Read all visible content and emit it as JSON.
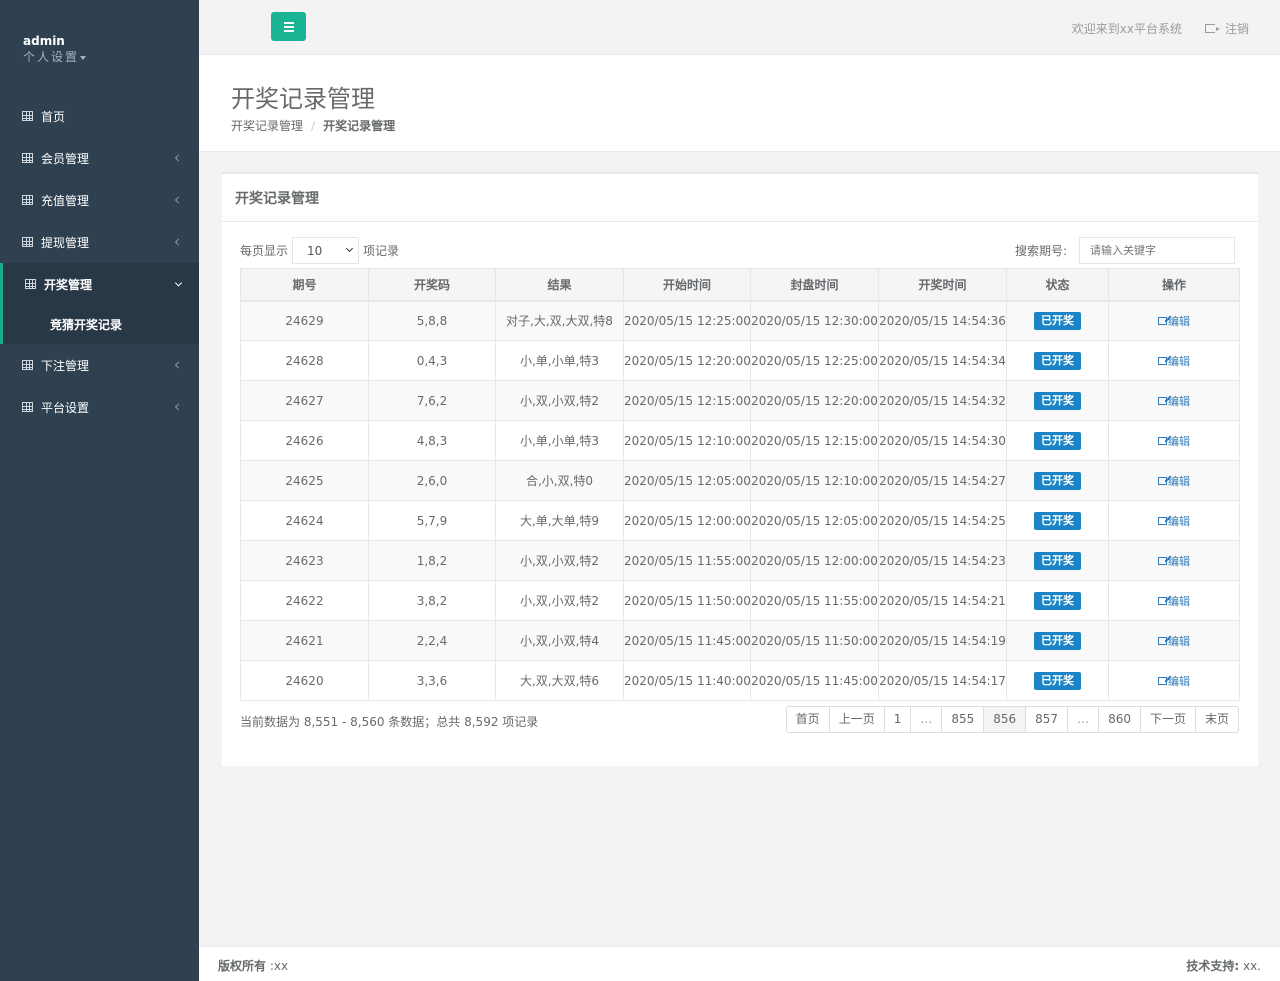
{
  "sidebar": {
    "user": "admin",
    "settings": "个人设置",
    "items": [
      {
        "label": "首页",
        "has_arrow": false
      },
      {
        "label": "会员管理",
        "has_arrow": true
      },
      {
        "label": "充值管理",
        "has_arrow": true
      },
      {
        "label": "提现管理",
        "has_arrow": true
      },
      {
        "label": "开奖管理",
        "has_arrow": true,
        "active": true
      },
      {
        "label": "竞猜开奖记录",
        "sub": true
      },
      {
        "label": "下注管理",
        "has_arrow": true
      },
      {
        "label": "平台设置",
        "has_arrow": true
      }
    ]
  },
  "topbar": {
    "welcome": "欢迎来到xx平台系统",
    "logout": "注销"
  },
  "heading": {
    "title": "开奖记录管理",
    "breadcrumb": [
      "开奖记录管理",
      "开奖记录管理"
    ]
  },
  "box": {
    "title": "开奖记录管理",
    "length_prefix": "每页显示",
    "length_value": "10",
    "length_suffix": "项记录",
    "search_label": "搜索期号:",
    "search_placeholder": "请输入关键字"
  },
  "table": {
    "columns": [
      "期号",
      "开奖码",
      "结果",
      "开始时间",
      "封盘时间",
      "开奖时间",
      "状态",
      "操作"
    ],
    "rows": [
      [
        "24629",
        "5,8,8",
        "对子,大,双,大双,特8",
        "2020/05/15 12:25:00",
        "2020/05/15 12:30:00",
        "2020/05/15 14:54:36",
        "已开奖",
        "编辑"
      ],
      [
        "24628",
        "0,4,3",
        "小,单,小单,特3",
        "2020/05/15 12:20:00",
        "2020/05/15 12:25:00",
        "2020/05/15 14:54:34",
        "已开奖",
        "编辑"
      ],
      [
        "24627",
        "7,6,2",
        "小,双,小双,特2",
        "2020/05/15 12:15:00",
        "2020/05/15 12:20:00",
        "2020/05/15 14:54:32",
        "已开奖",
        "编辑"
      ],
      [
        "24626",
        "4,8,3",
        "小,单,小单,特3",
        "2020/05/15 12:10:00",
        "2020/05/15 12:15:00",
        "2020/05/15 14:54:30",
        "已开奖",
        "编辑"
      ],
      [
        "24625",
        "2,6,0",
        "合,小,双,特0",
        "2020/05/15 12:05:00",
        "2020/05/15 12:10:00",
        "2020/05/15 14:54:27",
        "已开奖",
        "编辑"
      ],
      [
        "24624",
        "5,7,9",
        "大,单,大单,特9",
        "2020/05/15 12:00:00",
        "2020/05/15 12:05:00",
        "2020/05/15 14:54:25",
        "已开奖",
        "编辑"
      ],
      [
        "24623",
        "1,8,2",
        "小,双,小双,特2",
        "2020/05/15 11:55:00",
        "2020/05/15 12:00:00",
        "2020/05/15 14:54:23",
        "已开奖",
        "编辑"
      ],
      [
        "24622",
        "3,8,2",
        "小,双,小双,特2",
        "2020/05/15 11:50:00",
        "2020/05/15 11:55:00",
        "2020/05/15 14:54:21",
        "已开奖",
        "编辑"
      ],
      [
        "24621",
        "2,2,4",
        "小,双,小双,特4",
        "2020/05/15 11:45:00",
        "2020/05/15 11:50:00",
        "2020/05/15 14:54:19",
        "已开奖",
        "编辑"
      ],
      [
        "24620",
        "3,3,6",
        "大,双,大双,特6",
        "2020/05/15 11:40:00",
        "2020/05/15 11:45:00",
        "2020/05/15 14:54:17",
        "已开奖",
        "编辑"
      ]
    ]
  },
  "info": "当前数据为 8,551 - 8,560 条数据；总共 8,592 项记录",
  "pagination": [
    {
      "label": "首页"
    },
    {
      "label": "上一页"
    },
    {
      "label": "1"
    },
    {
      "label": "…",
      "disabled": true
    },
    {
      "label": "855"
    },
    {
      "label": "856",
      "active": true
    },
    {
      "label": "857"
    },
    {
      "label": "…",
      "disabled": true
    },
    {
      "label": "860"
    },
    {
      "label": "下一页"
    },
    {
      "label": "末页"
    }
  ],
  "footer": {
    "copyright_label": "版权所有",
    "copyright_value": " :xx",
    "support_label": "技术支持:",
    "support_value": " xx."
  },
  "colors": {
    "sidebar": "#2f4050",
    "accent": "#1ab394",
    "status_badge": "#1c84c6",
    "link": "#337ab7"
  }
}
